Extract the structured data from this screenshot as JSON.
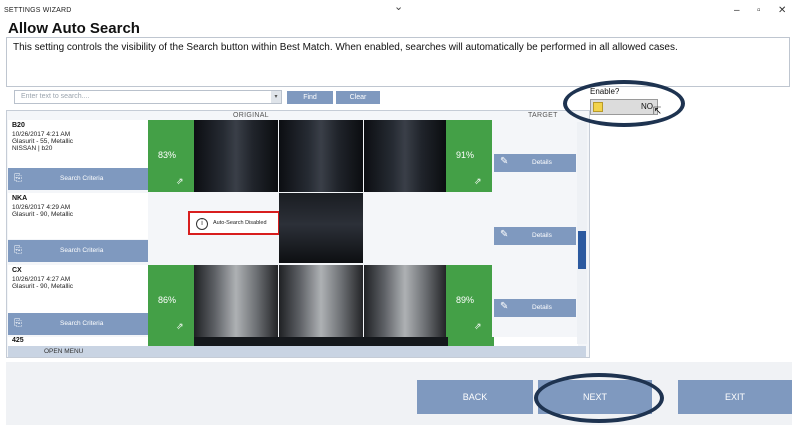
{
  "window": {
    "title": "SETTINGS WIZARD",
    "minimize": "–",
    "maximize": "▫",
    "close": "✕",
    "chevron": "⌄"
  },
  "page": {
    "heading": "Allow Auto Search",
    "description": "This setting controls the visibility of the Search button within Best Match.  When enabled, searches will automatically be performed in all allowed cases."
  },
  "search": {
    "placeholder": "Enter text to search....",
    "find_label": "Find",
    "clear_label": "Clear",
    "dropdown_glyph": "▾"
  },
  "list": {
    "col_original": "ORIGINAL",
    "col_target": "TARGET",
    "criteria_label": "Search Criteria",
    "details_label": "Details",
    "auto_search_disabled": "Auto-Search Disabled",
    "open_menu_label": "OPEN MENU",
    "partial_row_name": "425",
    "rows": [
      {
        "name": "B20",
        "date": "10/26/2017 4:21 AM",
        "line2": "Glasurit - 55, Metallic",
        "line3": "NISSAN | b20",
        "left_pct": "83%",
        "right_pct": "91%"
      },
      {
        "name": "NKA",
        "date": "10/26/2017 4:29 AM",
        "line2": "Glasurit - 90, Metallic",
        "line3": "",
        "left_pct": "",
        "right_pct": ""
      },
      {
        "name": "CX",
        "date": "10/26/2017 4:27 AM",
        "line2": "Glasurit - 90, Metallic",
        "line3": "",
        "left_pct": "86%",
        "right_pct": "89%"
      }
    ]
  },
  "enable": {
    "label": "Enable?",
    "value": "NO"
  },
  "nav": {
    "back": "BACK",
    "next": "NEXT",
    "exit": "EXIT"
  },
  "icons": {
    "criteria": "criteria-icon",
    "details": "pencil-icon",
    "export": "export-icon",
    "info": "info-icon"
  },
  "colors": {
    "accent": "#7f99bf",
    "match_green": "#44a047",
    "highlight_ring": "#1e3350",
    "warning_border": "#d81e1e"
  }
}
